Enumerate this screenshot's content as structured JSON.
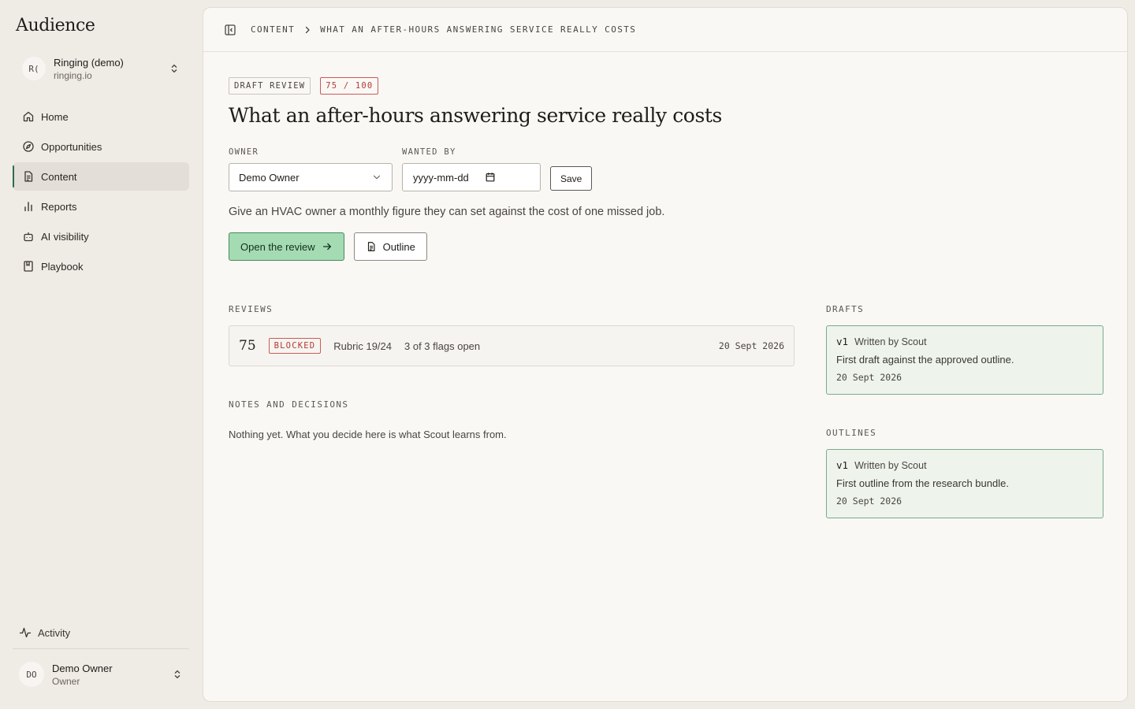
{
  "app": {
    "name": "Audience"
  },
  "workspace": {
    "initials": "R(",
    "name": "Ringing (demo)",
    "domain": "ringing.io"
  },
  "nav": {
    "items": [
      {
        "label": "Home",
        "icon": "home-icon"
      },
      {
        "label": "Opportunities",
        "icon": "compass-icon"
      },
      {
        "label": "Content",
        "icon": "document-icon",
        "active": true
      },
      {
        "label": "Reports",
        "icon": "bar-chart-icon"
      },
      {
        "label": "AI visibility",
        "icon": "robot-icon"
      },
      {
        "label": "Playbook",
        "icon": "book-icon"
      }
    ],
    "activity": "Activity"
  },
  "user": {
    "initials": "DO",
    "name": "Demo Owner",
    "role": "Owner"
  },
  "breadcrumb": {
    "root": "CONTENT",
    "current": "WHAT AN AFTER-HOURS ANSWERING SERVICE REALLY COSTS"
  },
  "page": {
    "status_tag": "DRAFT REVIEW",
    "score_tag": "75 / 100",
    "title": "What an after-hours answering service really costs",
    "description": "Give an HVAC owner a monthly figure they can set against the cost of one missed job."
  },
  "form": {
    "owner_label": "OWNER",
    "owner_value": "Demo Owner",
    "wanted_by_label": "WANTED BY",
    "wanted_by_placeholder": "yyyy-mm-dd",
    "save_label": "Save"
  },
  "actions": {
    "open_review": "Open the review",
    "outline": "Outline"
  },
  "reviews": {
    "label": "REVIEWS",
    "items": [
      {
        "score": "75",
        "status": "BLOCKED",
        "rubric": "Rubric 19/24",
        "flags": "3 of 3 flags open",
        "date": "20 Sept 2026"
      }
    ]
  },
  "notes": {
    "label": "NOTES AND DECISIONS",
    "empty": "Nothing yet. What you decide here is what Scout learns from."
  },
  "drafts": {
    "label": "DRAFTS",
    "items": [
      {
        "version": "v1",
        "author": "Written by Scout",
        "description": "First draft against the approved outline.",
        "date": "20 Sept 2026"
      }
    ]
  },
  "outlines": {
    "label": "OUTLINES",
    "items": [
      {
        "version": "v1",
        "author": "Written by Scout",
        "description": "First outline from the research bundle.",
        "date": "20 Sept 2026"
      }
    ]
  },
  "colors": {
    "accent": "#2f6b47",
    "primary_button": "#a4dbb3",
    "danger": "#b43a35",
    "card_green": "#eef3ec"
  }
}
